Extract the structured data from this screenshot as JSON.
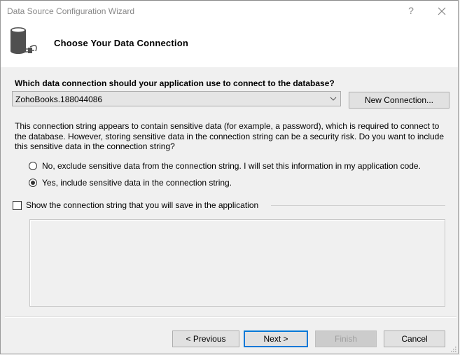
{
  "window": {
    "title": "Data Source Configuration Wizard",
    "help_label": "?",
    "close_icon": "close-icon"
  },
  "header": {
    "title": "Choose Your Data Connection",
    "icon": "database-plug-icon"
  },
  "connection": {
    "question": "Which data connection should your application use to connect to the database?",
    "selected": "ZohoBooks.188044086",
    "new_connection_label": "New Connection..."
  },
  "sensitive": {
    "description": "This connection string appears to contain sensitive data (for example, a password), which is required to connect to the database. However, storing sensitive data in the connection string can be a security risk. Do you want to include this sensitive data in the connection string?",
    "options": [
      {
        "label": "No, exclude sensitive data from the connection string. I will set this information in my application code.",
        "checked": false
      },
      {
        "label": "Yes, include sensitive data in the connection string.",
        "checked": true
      }
    ]
  },
  "show_connection_string": {
    "label": "Show the connection string that you will save in the application",
    "checked": false,
    "value": ""
  },
  "footer": {
    "previous_label": "< Previous",
    "next_label": "Next >",
    "finish_label": "Finish",
    "cancel_label": "Cancel"
  },
  "colors": {
    "accent": "#0078d7",
    "disabled_text": "#a0a0a0"
  }
}
